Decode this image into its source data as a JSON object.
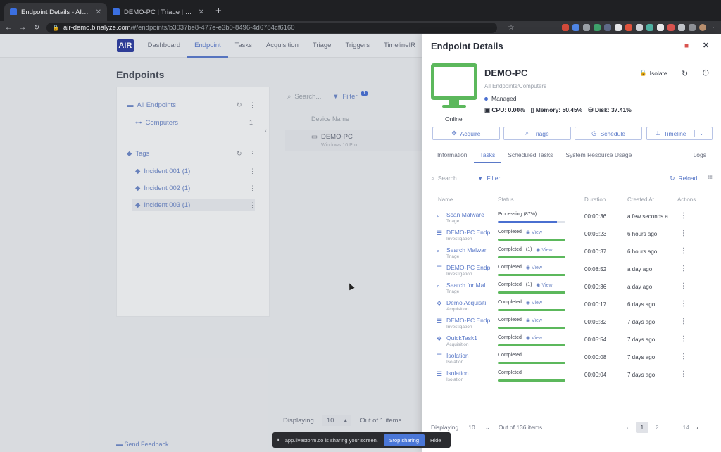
{
  "browser": {
    "tabs": [
      {
        "title": "Endpoint Details - AIR | Binaly"
      },
      {
        "title": "DEMO-PC | Triage | Memory"
      }
    ],
    "url_host": "air-demo.binalyze.com",
    "url_path": "/#/endpoints/b3037be8-477e-e3b0-8496-4d6784cf6160"
  },
  "app": {
    "logo": "AIR",
    "nav": [
      "Dashboard",
      "Endpoint",
      "Tasks",
      "Acquisition",
      "Triage",
      "Triggers",
      "TimelineIR"
    ],
    "page_title": "Endpoints",
    "tree": {
      "all": "All Endpoints",
      "computers": "Computers",
      "computers_count": "1",
      "tags": "Tags",
      "tag_items": [
        "Incident 001 (1)",
        "Incident 002 (1)",
        "Incident 003 (1)"
      ]
    },
    "search_placeholder": "Search...",
    "filter_label": "Filter",
    "filter_badge": "1",
    "device_col": "Device Name",
    "device_name": "DEMO-PC",
    "device_sub": "Windows 10 Pro",
    "displaying_label": "Displaying",
    "displaying_value": "10",
    "out_of": "Out of 1 items",
    "send_feedback": "Send Feedback"
  },
  "panel": {
    "title": "Endpoint Details",
    "status": "Online",
    "hostname": "DEMO-PC",
    "hostpath": "All Endpoints/Computers",
    "managed": "Managed",
    "cpu": "CPU: 0.00%",
    "memory": "Memory: 50.45%",
    "disk": "Disk: 37.41%",
    "isolate": "Isolate",
    "buttons": [
      "Acquire",
      "Triage",
      "Schedule",
      "Timeline"
    ],
    "tabs": [
      "Information",
      "Tasks",
      "Scheduled Tasks",
      "System Resource Usage",
      "Logs"
    ],
    "search_placeholder": "Search",
    "filter": "Filter",
    "reload": "Reload",
    "columns": [
      "Name",
      "Status",
      "Duration",
      "Created At",
      "Actions"
    ],
    "view_label": "View",
    "rows": [
      {
        "name": "Scan Malware I",
        "type": "Triage",
        "status": "Processing (87%)",
        "flag": "",
        "progress": 0.87,
        "duration": "00:00:36",
        "created": "a few seconds ago",
        "icon": "search-icon",
        "glyph": "⌕"
      },
      {
        "name": "DEMO-PC Endp",
        "type": "Investigation",
        "status": "Completed",
        "flag": "",
        "progress": 1,
        "duration": "00:05:23",
        "created": "6 hours ago",
        "icon": "list-icon",
        "glyph": "☰"
      },
      {
        "name": "Search Malwar",
        "type": "Triage",
        "status": "Completed",
        "flag": "(1)",
        "progress": 1,
        "duration": "00:00:37",
        "created": "6 hours ago",
        "icon": "search-icon",
        "glyph": "⌕"
      },
      {
        "name": "DEMO-PC Endp",
        "type": "Investigation",
        "status": "Completed",
        "flag": "",
        "progress": 1,
        "duration": "00:08:52",
        "created": "a day ago",
        "icon": "list-icon",
        "glyph": "☰"
      },
      {
        "name": "Search for Mal",
        "type": "Triage",
        "status": "Completed",
        "flag": "(1)",
        "progress": 1,
        "duration": "00:00:36",
        "created": "a day ago",
        "icon": "search-icon",
        "glyph": "⌕"
      },
      {
        "name": "Demo Acquisiti",
        "type": "Acquisition",
        "status": "Completed",
        "flag": "",
        "progress": 1,
        "duration": "00:00:17",
        "created": "6 days ago",
        "icon": "acquire-icon",
        "glyph": "✥"
      },
      {
        "name": "DEMO-PC Endp",
        "type": "Investigation",
        "status": "Completed",
        "flag": "",
        "progress": 1,
        "duration": "00:05:32",
        "created": "7 days ago",
        "icon": "list-icon",
        "glyph": "☰"
      },
      {
        "name": "QuickTask1",
        "type": "Acquisition",
        "status": "Completed",
        "flag": "",
        "progress": 1,
        "duration": "00:05:54",
        "created": "7 days ago",
        "icon": "acquire-icon",
        "glyph": "✥"
      },
      {
        "name": "Isolation",
        "type": "Isolation",
        "status": "Completed",
        "flag": "",
        "progress": 1,
        "duration": "00:00:08",
        "created": "7 days ago",
        "icon": "list-icon",
        "glyph": "☰"
      },
      {
        "name": "Isolation",
        "type": "Isolation",
        "status": "Completed",
        "flag": "",
        "progress": 1,
        "duration": "00:00:04",
        "created": "7 days ago",
        "icon": "list-icon",
        "glyph": "☰"
      }
    ],
    "displaying_label": "Displaying",
    "displaying_value": "10",
    "out_of": "Out of 136 items",
    "pages": [
      "1",
      "2",
      "14"
    ]
  },
  "share": {
    "text": "app.livestorm.co is sharing your screen.",
    "stop": "Stop sharing",
    "hide": "Hide"
  },
  "colors": {
    "accent": "#5a79c8",
    "online": "#5cb85c",
    "processing": "#4a6fd0"
  }
}
